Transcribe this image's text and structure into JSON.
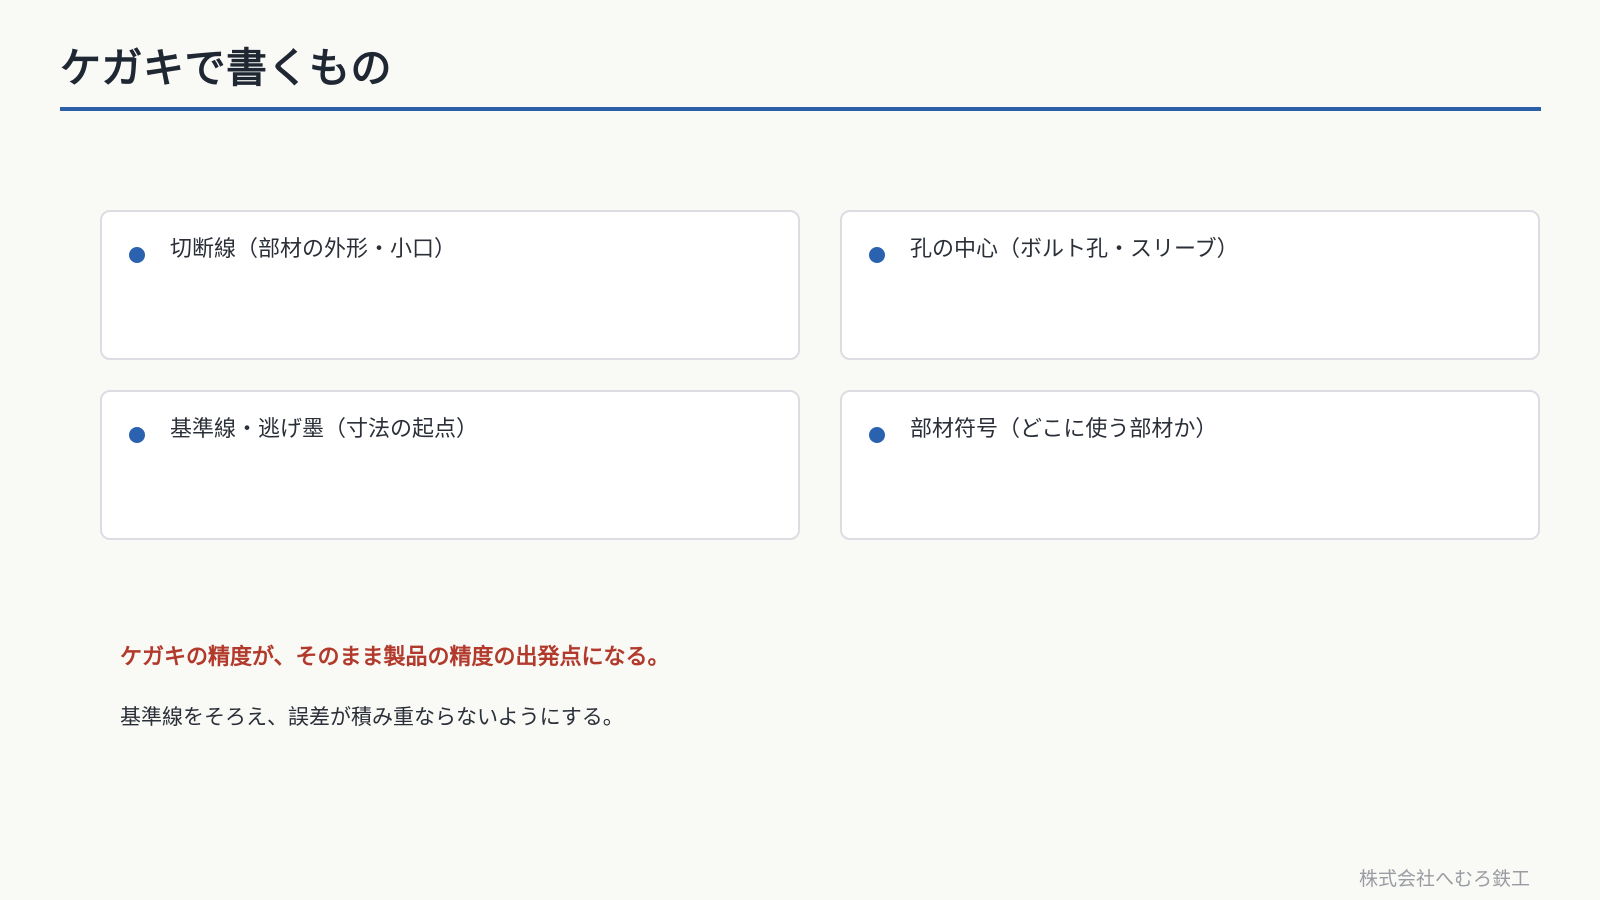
{
  "title": "ケガキで書くもの",
  "cards": [
    {
      "text": "切断線（部材の外形・小口）"
    },
    {
      "text": "孔の中心（ボルト孔・スリーブ）"
    },
    {
      "text": "基準線・逃げ墨（寸法の起点）"
    },
    {
      "text": "部材符号（どこに使う部材か）"
    }
  ],
  "emphasis": "ケガキの精度が、そのまま製品の精度の出発点になる。",
  "subtext": "基準線をそろえ、誤差が積み重ならないようにする。",
  "footer": "株式会社へむろ鉄工",
  "colors": {
    "accent": "#2c5fa8",
    "emphasis": "#b23a2c",
    "background": "#f9f9f6"
  }
}
